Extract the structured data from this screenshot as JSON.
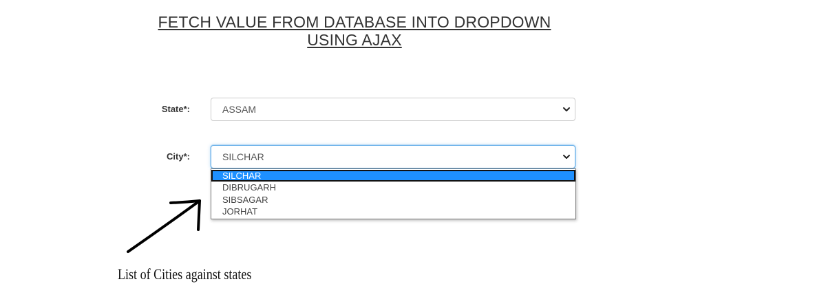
{
  "page": {
    "title": "FETCH VALUE FROM DATABASE INTO DROPDOWN USING AJAX"
  },
  "form": {
    "state_label": "State*:",
    "state_value": "ASSAM",
    "city_label": "City*:",
    "city_value": "SILCHAR"
  },
  "city_dropdown": {
    "options": [
      "SILCHAR",
      "DIBRUGARH",
      "SIBSAGAR",
      "JORHAT"
    ],
    "highlighted": "SILCHAR"
  },
  "annotation": {
    "caption": "List of Cities against states"
  },
  "colors": {
    "highlight": "#1e90ff",
    "focus_border": "#66afe9",
    "text": "#333333"
  },
  "icons": {
    "select_chevron": "chevron-down-icon",
    "annotation": "arrow-icon"
  }
}
